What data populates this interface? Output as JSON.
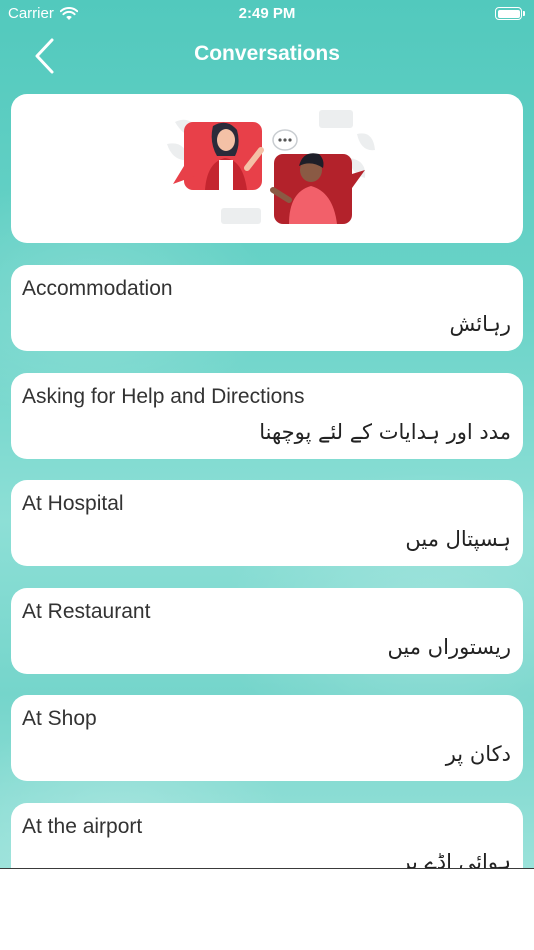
{
  "status_bar": {
    "carrier": "Carrier",
    "time": "2:49 PM"
  },
  "nav": {
    "title": "Conversations"
  },
  "categories": [
    {
      "title": "Accommodation",
      "urdu": "رہائش"
    },
    {
      "title": "Asking for Help and Directions",
      "urdu": "مدد اور ہدایات کے لئے پوچھنا"
    },
    {
      "title": "At Hospital",
      "urdu": "ہسپتال میں"
    },
    {
      "title": "At Restaurant",
      "urdu": "ریستوراں میں"
    },
    {
      "title": "At Shop",
      "urdu": "دکان پر"
    },
    {
      "title": "At the airport",
      "urdu": "ہوائی اڈے پر"
    }
  ],
  "colors": {
    "accent": "#52c9bd",
    "illustration_red": "#e84049",
    "illustration_dark_red": "#b3222b"
  }
}
